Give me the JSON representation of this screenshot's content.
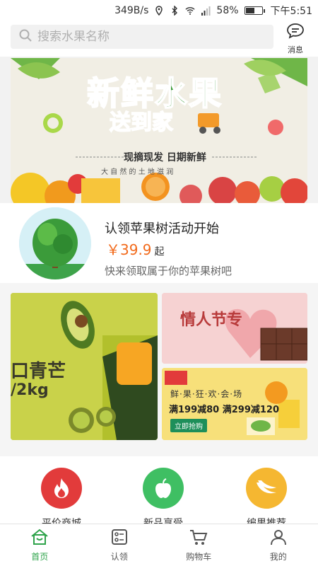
{
  "status_bar": {
    "speed": "349B/s",
    "battery": "58%",
    "time": "下午5:51",
    "battery_level": 0.58
  },
  "search": {
    "placeholder": "搜索水果名称",
    "icon": "search-icon"
  },
  "message": {
    "label": "消息",
    "icon": "chat-bubble-icon"
  },
  "banner": {
    "title_line1": "新鲜水果",
    "title_line2": "送到家",
    "tagline": "现摘现发 日期新鲜",
    "subtitle": "大 自 然 的 土 地 滋 润"
  },
  "promo": {
    "title": "认领苹果树活动开始",
    "price": "￥39.9",
    "price_suffix": "起",
    "description": "快来领取属于你的苹果树吧"
  },
  "cards": {
    "big": {
      "line1": "口青芒",
      "line2": "/2kg"
    },
    "top_right": {
      "text": "情人节专"
    },
    "bottom_right": {
      "line1": "鲜·果·狂·欢·会·场",
      "line2": "满199减80 满299减120",
      "button": "立即抢购"
    }
  },
  "categories": [
    {
      "label": "平价商城",
      "icon": "flame-icon",
      "color": "#e23b3b"
    },
    {
      "label": "新品享受",
      "icon": "apple-icon",
      "color": "#3fbf63"
    },
    {
      "label": "编果推荐",
      "icon": "banana-icon",
      "color": "#f5b731"
    }
  ],
  "tabs": [
    {
      "label": "首页",
      "icon": "home-icon",
      "active": true
    },
    {
      "label": "认领",
      "icon": "claim-icon",
      "active": false
    },
    {
      "label": "购物车",
      "icon": "cart-icon",
      "active": false
    },
    {
      "label": "我的",
      "icon": "user-icon",
      "active": false
    }
  ],
  "colors": {
    "accent": "#2ea34a",
    "price": "#f26a1b"
  }
}
